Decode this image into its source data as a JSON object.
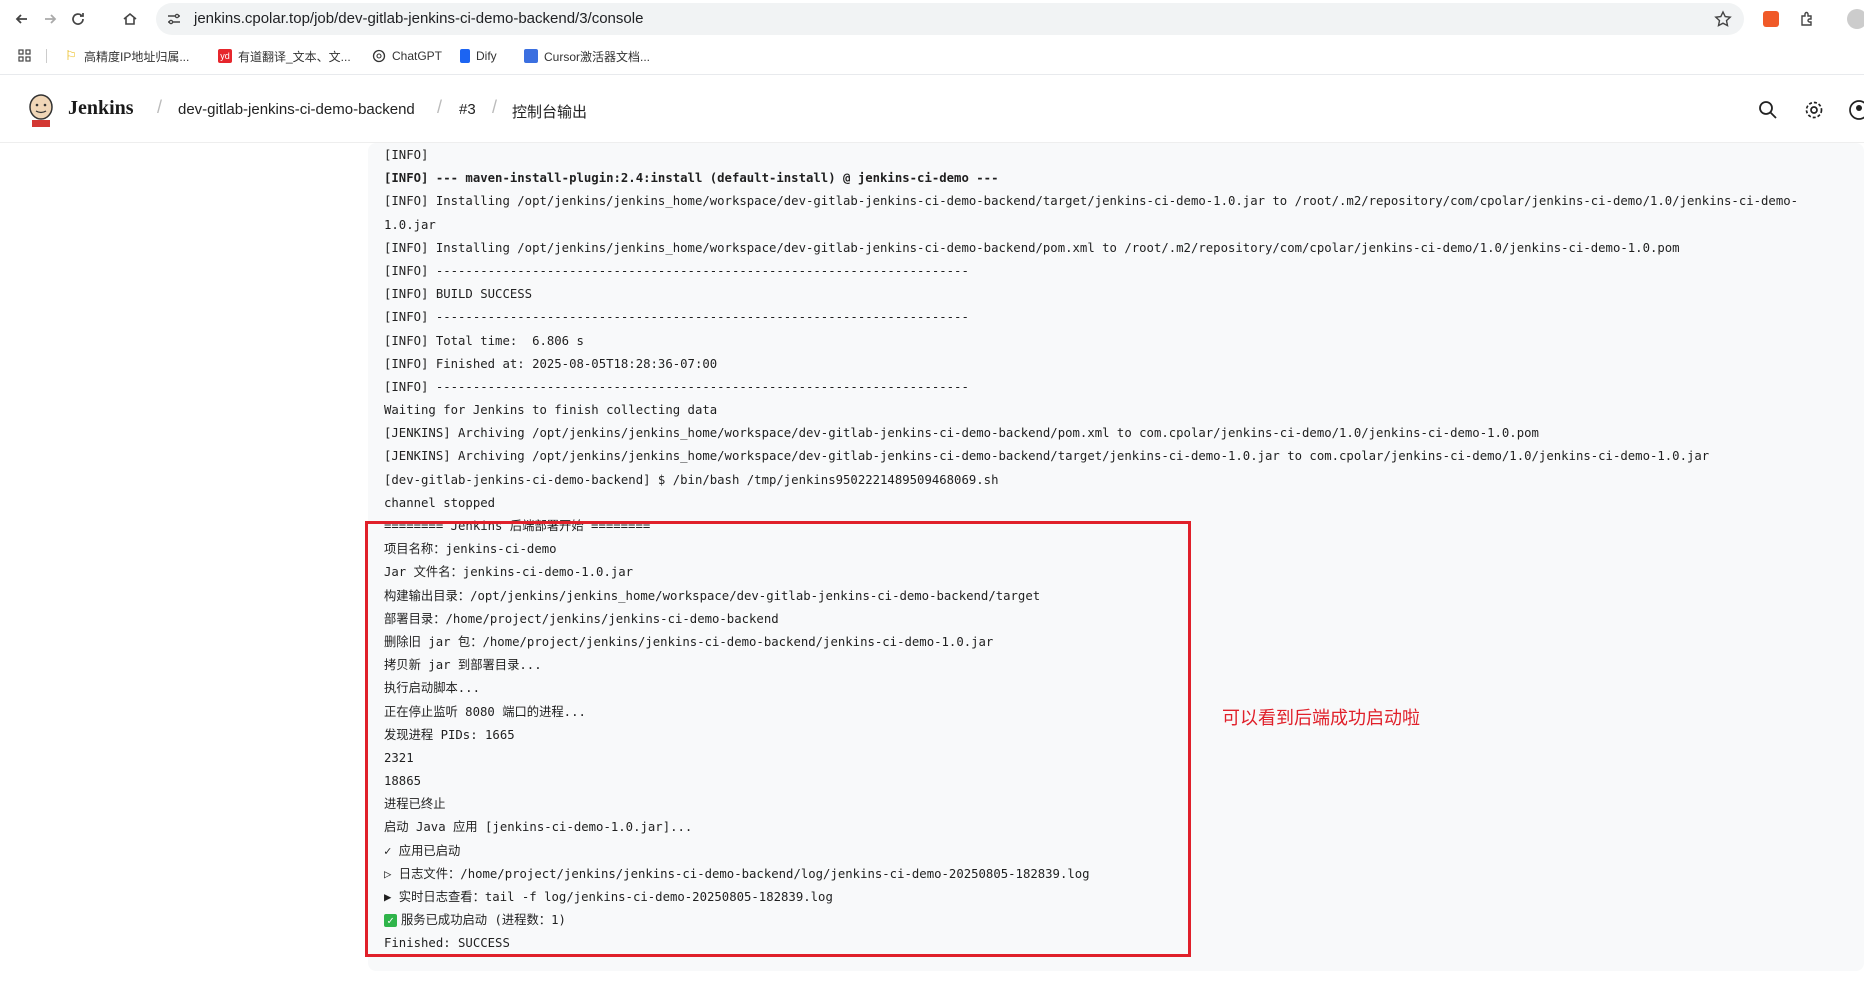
{
  "browser": {
    "url": "jenkins.cpolar.top/job/dev-gitlab-jenkins-ci-demo-backend/3/console",
    "bookmarks": [
      {
        "label": "高精度IP地址归属...",
        "icon": "yellow-flag-icon"
      },
      {
        "label": "有道翻译_文本、文...",
        "icon": "youdao-icon"
      },
      {
        "label": "ChatGPT",
        "icon": "chatgpt-icon"
      },
      {
        "label": "Dify",
        "icon": "dify-icon"
      },
      {
        "label": "Cursor激活器文档...",
        "icon": "doc-icon"
      }
    ],
    "youdao_badge": "yd"
  },
  "header": {
    "app_title": "Jenkins",
    "breadcrumbs": [
      "dev-gitlab-jenkins-ci-demo-backend",
      "#3",
      "控制台输出"
    ]
  },
  "console": {
    "lines": [
      "[INFO]",
      "[INFO] --- maven-install-plugin:2.4:install (default-install) @ jenkins-ci-demo ---",
      "[INFO] Installing /opt/jenkins/jenkins_home/workspace/dev-gitlab-jenkins-ci-demo-backend/target/jenkins-ci-demo-1.0.jar to /root/.m2/repository/com/cpolar/jenkins-ci-demo/1.0/jenkins-ci-demo-",
      "1.0.jar",
      "[INFO] Installing /opt/jenkins/jenkins_home/workspace/dev-gitlab-jenkins-ci-demo-backend/pom.xml to /root/.m2/repository/com/cpolar/jenkins-ci-demo/1.0/jenkins-ci-demo-1.0.pom",
      "[INFO] ------------------------------------------------------------------------",
      "[INFO] BUILD SUCCESS",
      "[INFO] ------------------------------------------------------------------------",
      "[INFO] Total time:  6.806 s",
      "[INFO] Finished at: 2025-08-05T18:28:36-07:00",
      "[INFO] ------------------------------------------------------------------------",
      "Waiting for Jenkins to finish collecting data",
      "[JENKINS] Archiving /opt/jenkins/jenkins_home/workspace/dev-gitlab-jenkins-ci-demo-backend/pom.xml to com.cpolar/jenkins-ci-demo/1.0/jenkins-ci-demo-1.0.pom",
      "[JENKINS] Archiving /opt/jenkins/jenkins_home/workspace/dev-gitlab-jenkins-ci-demo-backend/target/jenkins-ci-demo-1.0.jar to com.cpolar/jenkins-ci-demo/1.0/jenkins-ci-demo-1.0.jar",
      "[dev-gitlab-jenkins-ci-demo-backend] $ /bin/bash /tmp/jenkins9502221489509468069.sh",
      "channel stopped",
      "======== Jenkins 后端部署开始 ========",
      "项目名称：jenkins-ci-demo",
      "Jar 文件名：jenkins-ci-demo-1.0.jar",
      "构建输出目录：/opt/jenkins/jenkins_home/workspace/dev-gitlab-jenkins-ci-demo-backend/target",
      "部署目录：/home/project/jenkins/jenkins-ci-demo-backend",
      "删除旧 jar 包：/home/project/jenkins/jenkins-ci-demo-backend/jenkins-ci-demo-1.0.jar",
      "拷贝新 jar 到部署目录...",
      "执行启动脚本...",
      "正在停止监听 8080 端口的进程...",
      "发现进程 PIDs: 1665",
      "2321",
      "18865",
      "进程已终止",
      "启动 Java 应用 [jenkins-ci-demo-1.0.jar]...",
      "✓ 应用已启动",
      "▷ 日志文件：/home/project/jenkins/jenkins-ci-demo-backend/log/jenkins-ci-demo-20250805-182839.log",
      "▶ 实时日志查看：tail -f log/jenkins-ci-demo-20250805-182839.log",
      "服务已成功启动 (进程数：1)",
      "Finished: SUCCESS"
    ],
    "check_mark": "✓"
  },
  "annotation": "可以看到后端成功启动啦",
  "colors": {
    "highlight": "#e0202a",
    "console_bg": "#f8f9fa"
  }
}
